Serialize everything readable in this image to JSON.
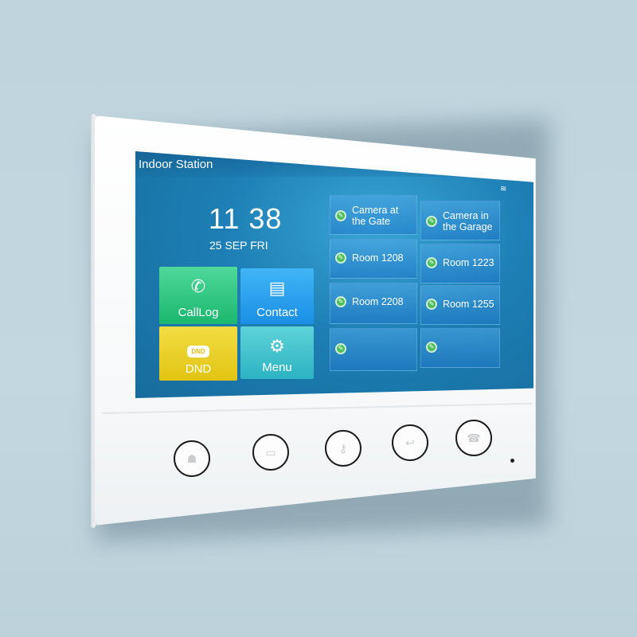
{
  "device": {
    "screen_title": "Indoor Station",
    "status_icons": [
      "wifi-icon"
    ],
    "clock": {
      "time": "11 38",
      "date": "25 SEP FRI"
    },
    "main_tiles": [
      {
        "label": "CallLog",
        "icon": "call-log-icon",
        "color": "#1fbf74"
      },
      {
        "label": "Contact",
        "icon": "contact-book-icon",
        "color": "#2196ee"
      },
      {
        "label": "DND",
        "icon": "dnd-sign-icon",
        "badge": "DND",
        "color": "#e6c815"
      },
      {
        "label": "Menu",
        "icon": "gear-icon",
        "color": "#33b8c5"
      }
    ],
    "quick_keys": [
      {
        "label_line1": "Camera at",
        "label_line2": "the Gate"
      },
      {
        "label_line1": "Camera in",
        "label_line2": "the Garage"
      },
      {
        "label_line1": "Room 1208",
        "label_line2": ""
      },
      {
        "label_line1": "Room 1223",
        "label_line2": ""
      },
      {
        "label_line1": "Room 2208",
        "label_line2": ""
      },
      {
        "label_line1": "Room 1255",
        "label_line2": ""
      },
      {
        "label_line1": "",
        "label_line2": ""
      },
      {
        "label_line1": "",
        "label_line2": ""
      }
    ],
    "quick_key_icon": "edit-pencil-icon",
    "hardware_buttons": [
      {
        "icon": "monitor-person-icon",
        "glyph": "☗"
      },
      {
        "icon": "video-camera-icon",
        "glyph": "▭"
      },
      {
        "icon": "key-icon",
        "glyph": "⚷"
      },
      {
        "icon": "return-arrow-icon",
        "glyph": "↩"
      },
      {
        "icon": "hang-up-icon",
        "glyph": "☎"
      }
    ],
    "wifi_glyph": "≋",
    "calllog_glyph": "✆",
    "contact_glyph": "▤",
    "menu_glyph": "⚙",
    "pencil_glyph": "✎"
  }
}
